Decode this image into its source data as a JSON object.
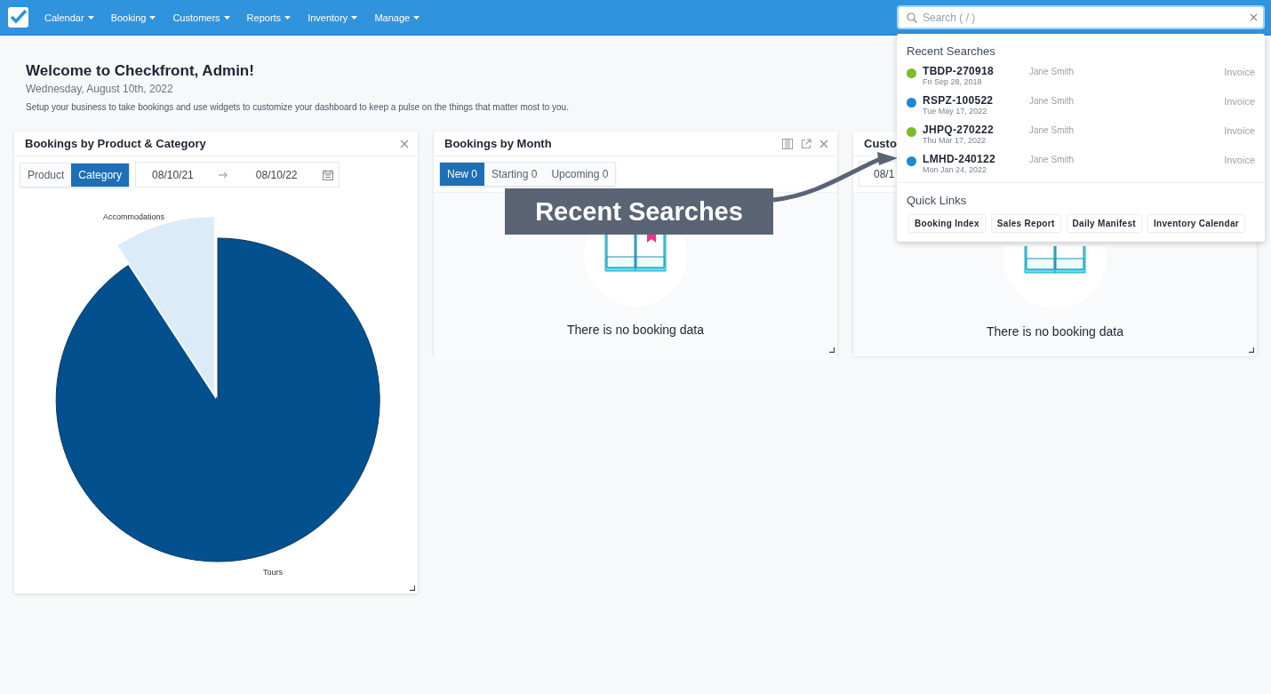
{
  "nav": {
    "items": [
      {
        "label": "Calendar"
      },
      {
        "label": "Booking"
      },
      {
        "label": "Customers"
      },
      {
        "label": "Reports"
      },
      {
        "label": "Inventory"
      },
      {
        "label": "Manage"
      }
    ]
  },
  "search": {
    "placeholder": "Search ( / )"
  },
  "welcome": {
    "title": "Welcome to Checkfront, Admin!",
    "date": "Wednesday, August 10th, 2022",
    "text": "Setup your business to take bookings and use widgets to customize your dashboard to keep a pulse on the things that matter most to you."
  },
  "widgets": [
    {
      "kind": "pie",
      "title": "Bookings by Product & Category",
      "toggle": [
        {
          "label": "Product",
          "selected": false
        },
        {
          "label": "Category",
          "selected": true
        }
      ],
      "date_from": "08/10/21",
      "date_to": "08/10/22",
      "slice_labels": [
        "Accommodations",
        "Tours"
      ]
    },
    {
      "kind": "month",
      "title": "Bookings by Month",
      "tabs": [
        {
          "label": "New 0",
          "selected": true
        },
        {
          "label": "Starting 0",
          "selected": false
        },
        {
          "label": "Upcoming 0",
          "selected": false
        }
      ],
      "message": "There is no booking data"
    },
    {
      "kind": "customer",
      "title": "Custo",
      "date_from": "08/1",
      "message": "There is no booking data"
    }
  ],
  "callout": {
    "text": "Recent Searches"
  },
  "dropdown": {
    "recent_title": "Recent Searches",
    "recent": [
      {
        "code": "TBDP-270918",
        "date": "Fri Sep 28, 2018",
        "name": "Jane Smith",
        "type": "Invoice",
        "color": "#7cbb2c"
      },
      {
        "code": "RSPZ-100522",
        "date": "Tue May 17, 2022",
        "name": "Jane Smith",
        "type": "Invoice",
        "color": "#1e88d6"
      },
      {
        "code": "JHPQ-270222",
        "date": "Thu Mar 17, 2022",
        "name": "Jane Smith",
        "type": "Invoice",
        "color": "#7cbb2c"
      },
      {
        "code": "LMHD-240122",
        "date": "Mon Jan 24, 2022",
        "name": "Jane Smith",
        "type": "Invoice",
        "color": "#1e88d6"
      }
    ],
    "quick_title": "Quick Links",
    "quick_links": [
      "Booking Index",
      "Sales Report",
      "Daily Manifest",
      "Inventory Calendar"
    ]
  }
}
